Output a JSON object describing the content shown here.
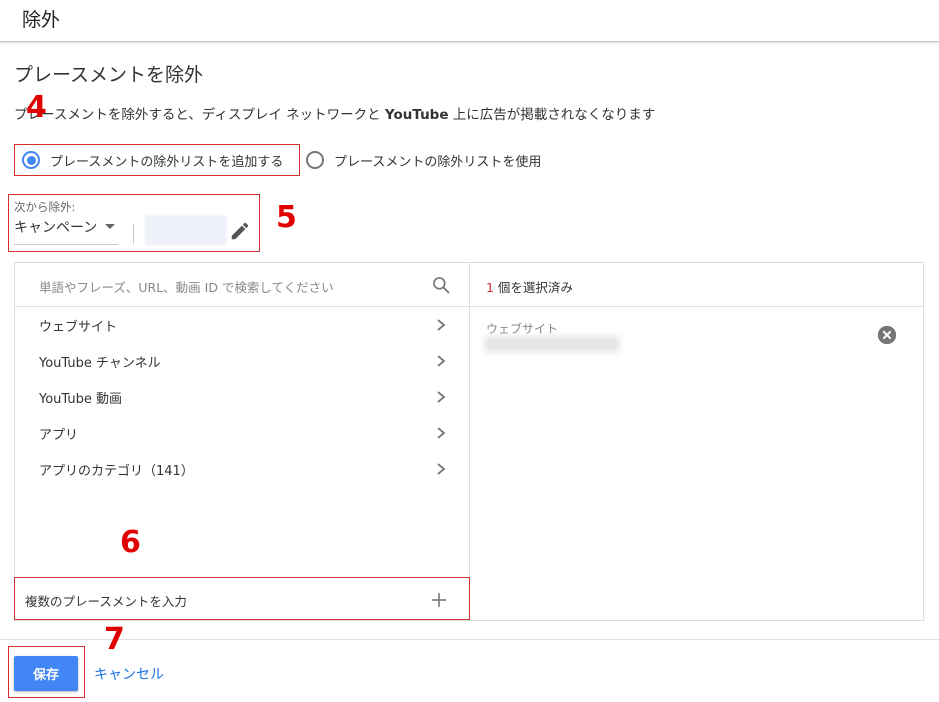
{
  "header": {
    "title": "除外"
  },
  "section": {
    "title": "プレースメントを除外",
    "description_prefix": "プレースメントを除外すると、ディスプレイ ネットワークと ",
    "description_bold": "YouTube",
    "description_suffix": " 上に広告が掲載されなくなります"
  },
  "radios": [
    {
      "label": "プレースメントの除外リストを追加する",
      "checked": true
    },
    {
      "label": "プレースメントの除外リストを使用",
      "checked": false
    }
  ],
  "exclude_from": {
    "label": "次から除外:",
    "selected": "キャンペーン"
  },
  "search": {
    "placeholder": "単語やフレーズ、URL、動画 ID で検索してください"
  },
  "categories": [
    "ウェブサイト",
    "YouTube チャンネル",
    "YouTube 動画",
    "アプリ",
    "アプリのカテゴリ（141）"
  ],
  "multi_entry": {
    "label": "複数のプレースメントを入力"
  },
  "selected_panel": {
    "count": "1",
    "count_suffix": " 個を選択済み",
    "item_type": "ウェブサイト"
  },
  "footer": {
    "save": "保存",
    "cancel": "キャンセル"
  },
  "annotations": [
    "4",
    "5",
    "6",
    "7"
  ],
  "colors": {
    "accent": "#4285f4",
    "annotation": "#e00000",
    "link": "#1a73e8"
  },
  "icons": [
    "search-icon",
    "chevron-right-icon",
    "plus-icon",
    "pencil-icon",
    "close-circle-icon"
  ]
}
